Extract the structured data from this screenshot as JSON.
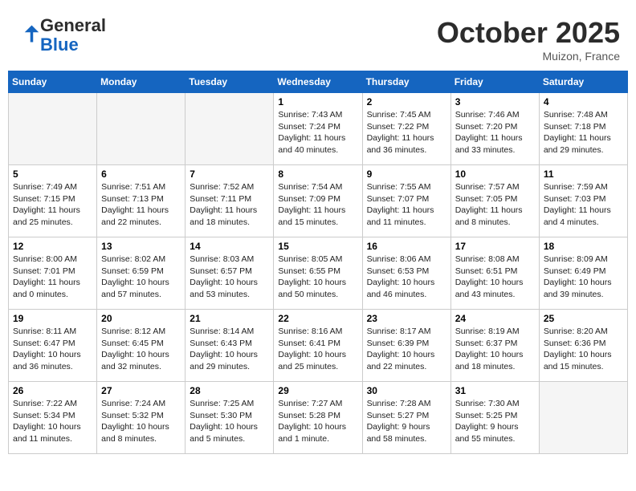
{
  "header": {
    "logo_line1": "General",
    "logo_line2": "Blue",
    "month": "October 2025",
    "location": "Muizon, France"
  },
  "weekdays": [
    "Sunday",
    "Monday",
    "Tuesday",
    "Wednesday",
    "Thursday",
    "Friday",
    "Saturday"
  ],
  "weeks": [
    [
      {
        "day": "",
        "text": ""
      },
      {
        "day": "",
        "text": ""
      },
      {
        "day": "",
        "text": ""
      },
      {
        "day": "1",
        "text": "Sunrise: 7:43 AM\nSunset: 7:24 PM\nDaylight: 11 hours and 40 minutes."
      },
      {
        "day": "2",
        "text": "Sunrise: 7:45 AM\nSunset: 7:22 PM\nDaylight: 11 hours and 36 minutes."
      },
      {
        "day": "3",
        "text": "Sunrise: 7:46 AM\nSunset: 7:20 PM\nDaylight: 11 hours and 33 minutes."
      },
      {
        "day": "4",
        "text": "Sunrise: 7:48 AM\nSunset: 7:18 PM\nDaylight: 11 hours and 29 minutes."
      }
    ],
    [
      {
        "day": "5",
        "text": "Sunrise: 7:49 AM\nSunset: 7:15 PM\nDaylight: 11 hours and 25 minutes."
      },
      {
        "day": "6",
        "text": "Sunrise: 7:51 AM\nSunset: 7:13 PM\nDaylight: 11 hours and 22 minutes."
      },
      {
        "day": "7",
        "text": "Sunrise: 7:52 AM\nSunset: 7:11 PM\nDaylight: 11 hours and 18 minutes."
      },
      {
        "day": "8",
        "text": "Sunrise: 7:54 AM\nSunset: 7:09 PM\nDaylight: 11 hours and 15 minutes."
      },
      {
        "day": "9",
        "text": "Sunrise: 7:55 AM\nSunset: 7:07 PM\nDaylight: 11 hours and 11 minutes."
      },
      {
        "day": "10",
        "text": "Sunrise: 7:57 AM\nSunset: 7:05 PM\nDaylight: 11 hours and 8 minutes."
      },
      {
        "day": "11",
        "text": "Sunrise: 7:59 AM\nSunset: 7:03 PM\nDaylight: 11 hours and 4 minutes."
      }
    ],
    [
      {
        "day": "12",
        "text": "Sunrise: 8:00 AM\nSunset: 7:01 PM\nDaylight: 11 hours and 0 minutes."
      },
      {
        "day": "13",
        "text": "Sunrise: 8:02 AM\nSunset: 6:59 PM\nDaylight: 10 hours and 57 minutes."
      },
      {
        "day": "14",
        "text": "Sunrise: 8:03 AM\nSunset: 6:57 PM\nDaylight: 10 hours and 53 minutes."
      },
      {
        "day": "15",
        "text": "Sunrise: 8:05 AM\nSunset: 6:55 PM\nDaylight: 10 hours and 50 minutes."
      },
      {
        "day": "16",
        "text": "Sunrise: 8:06 AM\nSunset: 6:53 PM\nDaylight: 10 hours and 46 minutes."
      },
      {
        "day": "17",
        "text": "Sunrise: 8:08 AM\nSunset: 6:51 PM\nDaylight: 10 hours and 43 minutes."
      },
      {
        "day": "18",
        "text": "Sunrise: 8:09 AM\nSunset: 6:49 PM\nDaylight: 10 hours and 39 minutes."
      }
    ],
    [
      {
        "day": "19",
        "text": "Sunrise: 8:11 AM\nSunset: 6:47 PM\nDaylight: 10 hours and 36 minutes."
      },
      {
        "day": "20",
        "text": "Sunrise: 8:12 AM\nSunset: 6:45 PM\nDaylight: 10 hours and 32 minutes."
      },
      {
        "day": "21",
        "text": "Sunrise: 8:14 AM\nSunset: 6:43 PM\nDaylight: 10 hours and 29 minutes."
      },
      {
        "day": "22",
        "text": "Sunrise: 8:16 AM\nSunset: 6:41 PM\nDaylight: 10 hours and 25 minutes."
      },
      {
        "day": "23",
        "text": "Sunrise: 8:17 AM\nSunset: 6:39 PM\nDaylight: 10 hours and 22 minutes."
      },
      {
        "day": "24",
        "text": "Sunrise: 8:19 AM\nSunset: 6:37 PM\nDaylight: 10 hours and 18 minutes."
      },
      {
        "day": "25",
        "text": "Sunrise: 8:20 AM\nSunset: 6:36 PM\nDaylight: 10 hours and 15 minutes."
      }
    ],
    [
      {
        "day": "26",
        "text": "Sunrise: 7:22 AM\nSunset: 5:34 PM\nDaylight: 10 hours and 11 minutes."
      },
      {
        "day": "27",
        "text": "Sunrise: 7:24 AM\nSunset: 5:32 PM\nDaylight: 10 hours and 8 minutes."
      },
      {
        "day": "28",
        "text": "Sunrise: 7:25 AM\nSunset: 5:30 PM\nDaylight: 10 hours and 5 minutes."
      },
      {
        "day": "29",
        "text": "Sunrise: 7:27 AM\nSunset: 5:28 PM\nDaylight: 10 hours and 1 minute."
      },
      {
        "day": "30",
        "text": "Sunrise: 7:28 AM\nSunset: 5:27 PM\nDaylight: 9 hours and 58 minutes."
      },
      {
        "day": "31",
        "text": "Sunrise: 7:30 AM\nSunset: 5:25 PM\nDaylight: 9 hours and 55 minutes."
      },
      {
        "day": "",
        "text": ""
      }
    ]
  ]
}
